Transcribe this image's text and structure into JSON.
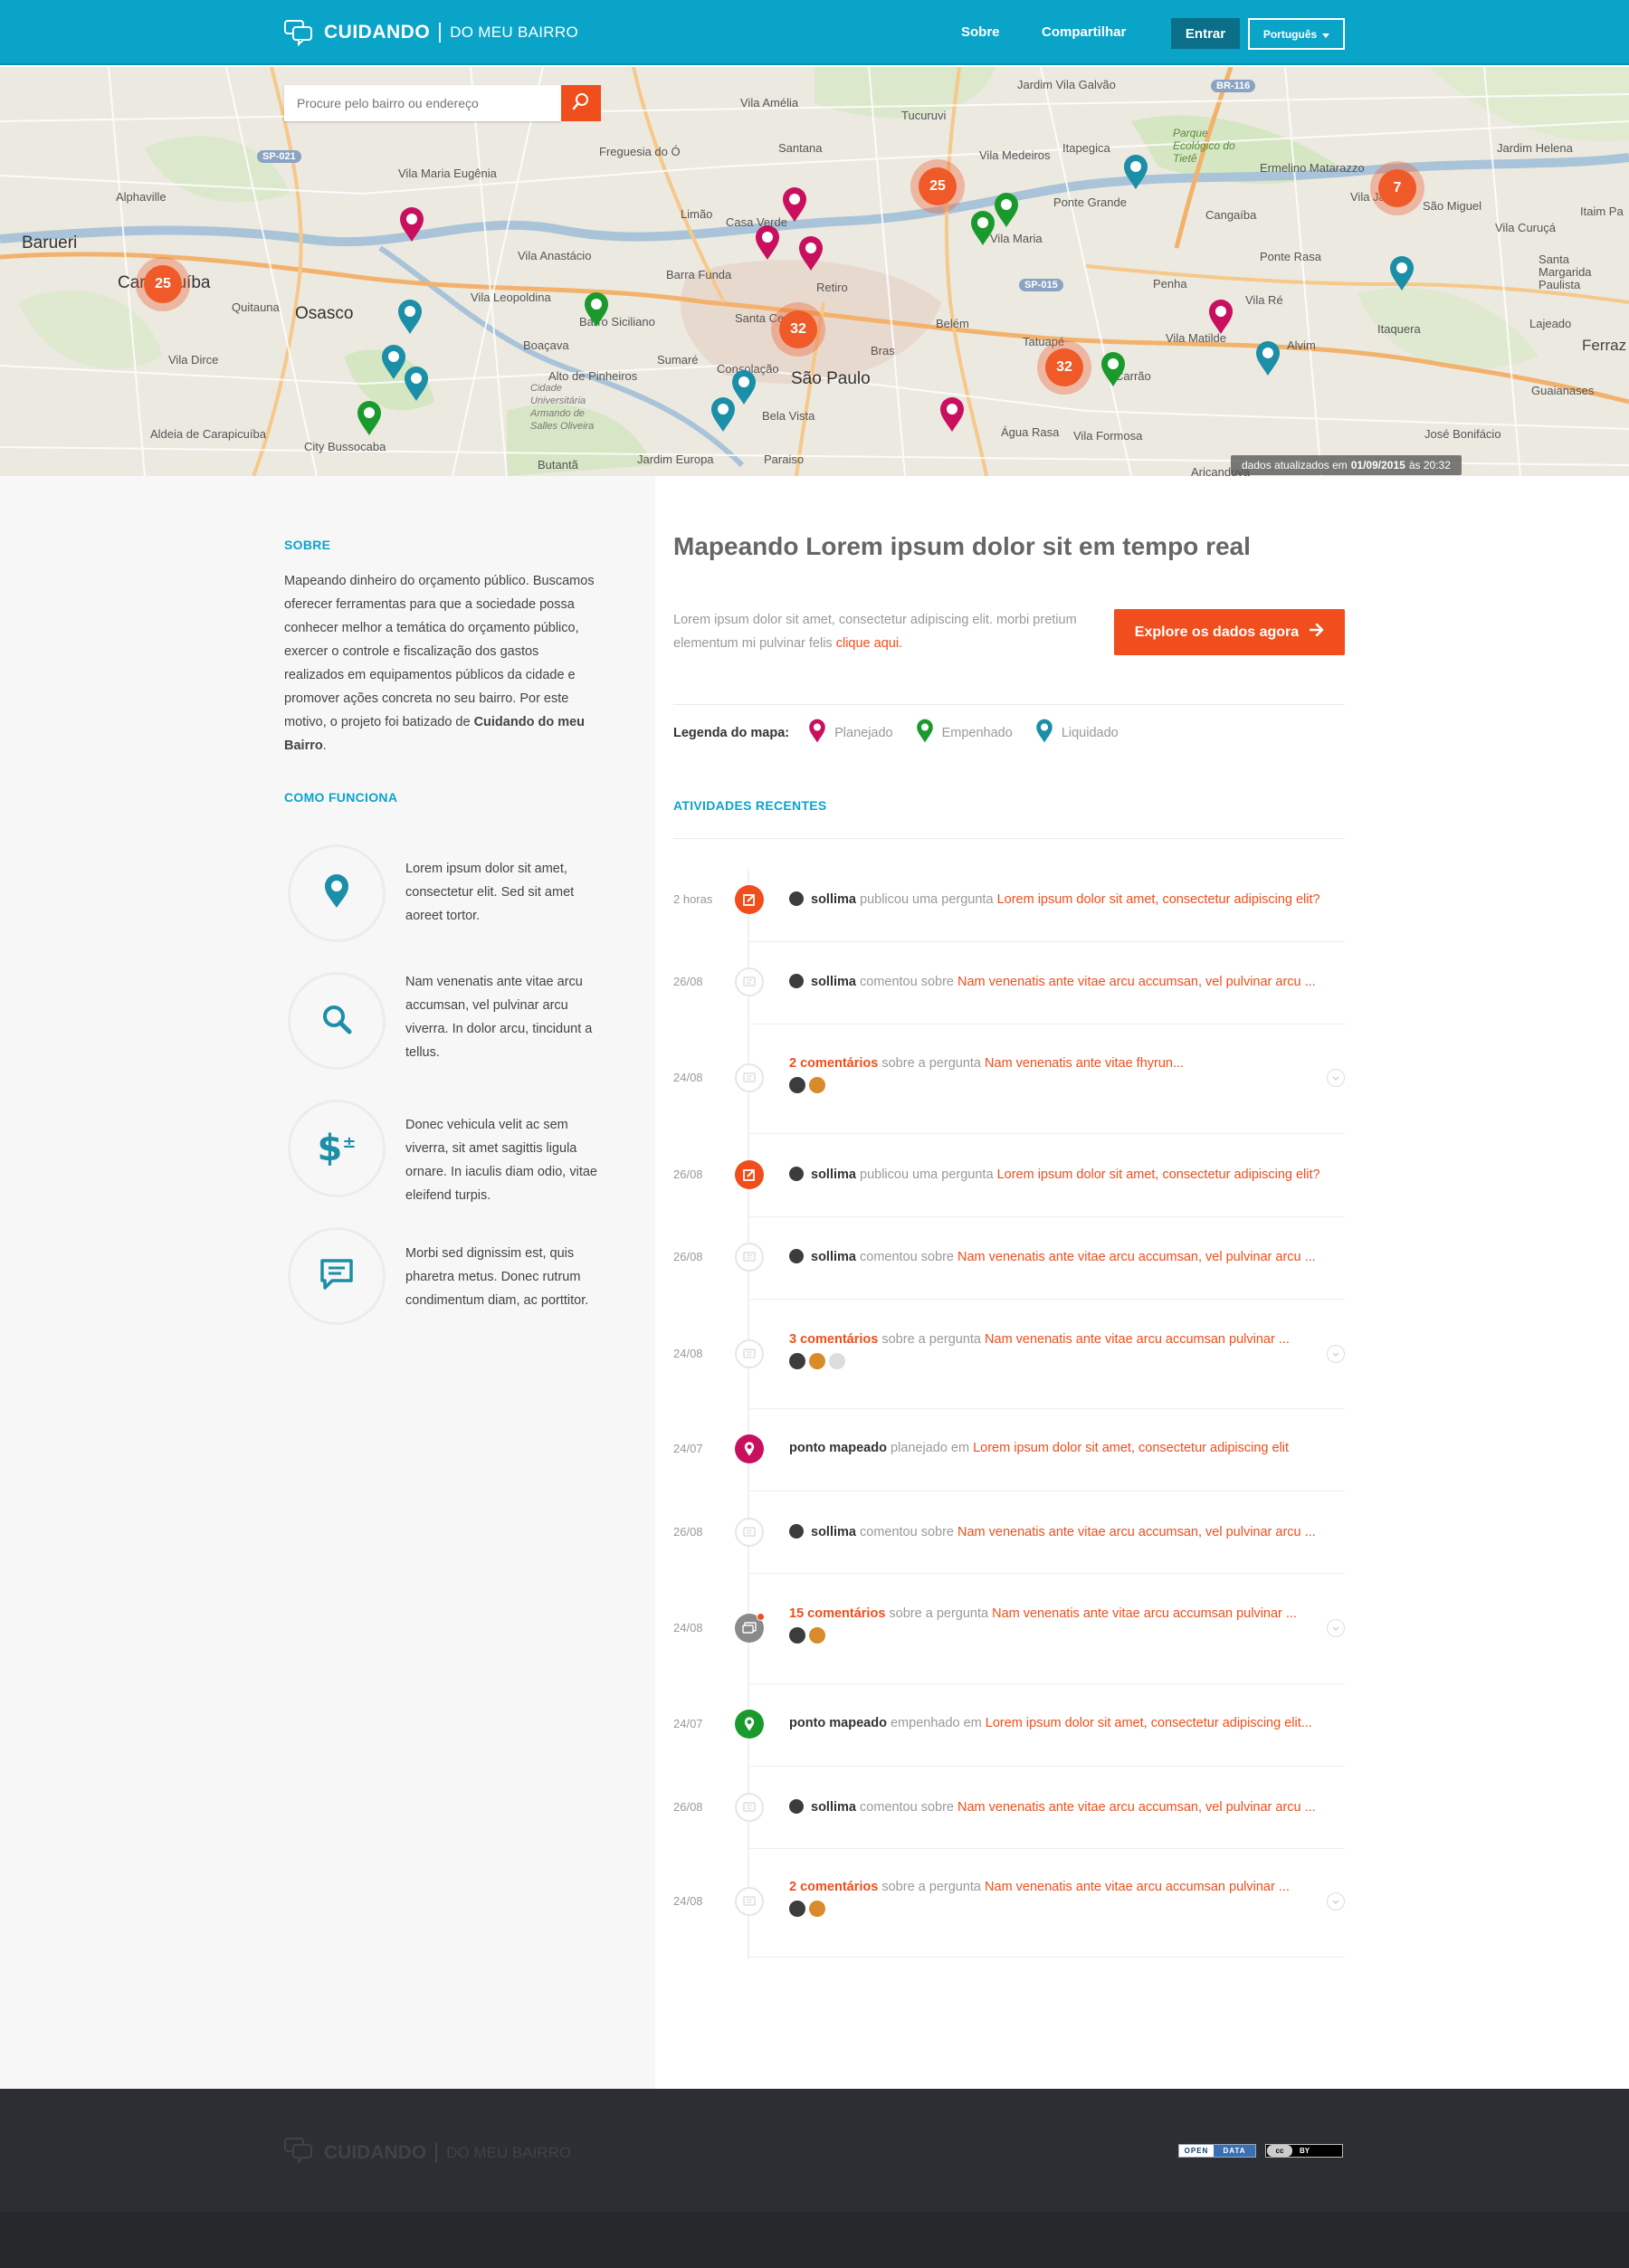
{
  "header": {
    "logo_word1": "CUIDANDO",
    "logo_word2": "DO MEU BAIRRO",
    "nav": [
      "Sobre",
      "Compartilhar"
    ],
    "login_label": "Entrar",
    "language_label": "Português"
  },
  "map": {
    "search_placeholder": "Procure pelo bairro ou endereço",
    "updated_prefix": "dados atualizados em",
    "updated_date": "01/09/2015",
    "updated_mid": "às",
    "updated_time": "20:32",
    "clusters": [
      "25",
      "25",
      "7",
      "32",
      "32"
    ],
    "labels": [
      "Barueri",
      "Alphaville",
      "Osasco",
      "Vila Anastácio",
      "Vila Leopoldina",
      "Boaçava",
      "Alto de Pinheiros",
      "Sumaré",
      "Barra Funda",
      "Santa Cecília",
      "Bela Vista",
      "São Paulo",
      "Bras",
      "Belém",
      "Tatuapé",
      "Vila Formosa",
      "Vila Matilde",
      "Ponte Rasa",
      "Penha",
      "Itaquera",
      "São Miguel",
      "Ermelino Matarazzo",
      "Jardim Helena",
      "Vila Maria",
      "Vila Medeiros",
      "Tucuruvi",
      "Santana",
      "Vila Amélia",
      "Freguesia do Ó",
      "Limão",
      "Casa Verde",
      "Vila Maria Eugênia",
      "Quitauna",
      "Vila Dirce",
      "Aldeia de Carapicuíba",
      "City Bussocaba",
      "Butantã",
      "Jardim Europa",
      "Paraiso",
      "Água Rasa",
      "José Bonifácio",
      "Guaianases",
      "Lajeado",
      "Ferraz",
      "Vila Curuçá",
      "Santa Margarida Paulista",
      "Cangaíba",
      "Vila Ré",
      "Jardim Vila Galvão",
      "Itapegica",
      "Parque Ecológico do Tietê",
      "Vila Jacuí",
      "Itaim Pa",
      "Cidade Universitária Armando de Salles Oliveira",
      "Carapicuíba",
      "Barro Siciliano",
      "Retiro",
      "Consolação",
      "Aricanduva",
      "Carrão",
      "Ponte Grande",
      "SP-021",
      "SP-015",
      "BR-116",
      "Alvim"
    ]
  },
  "sidebar": {
    "about_heading": "SOBRE",
    "about_text_1": "Mapeando dinheiro do orçamento público. Buscamos oferecer ferramentas para que a sociedade possa conhecer melhor a temática do orçamento público, exercer o controle e fiscalização dos gastos realizados em equipamentos públicos da cidade e promover ações concreta no seu bairro. Por este motivo, o projeto foi batizado de ",
    "about_text_bold": "Cuidando do meu Bairro",
    "about_text_end": ".",
    "how_heading": "COMO FUNCIONA",
    "how_items": [
      {
        "icon": "map-pin-icon",
        "text": "Lorem ipsum dolor sit amet, consectetur  elit. Sed sit amet aoreet tortor."
      },
      {
        "icon": "search-icon",
        "text": "Nam venenatis ante vitae arcu accumsan, vel pulvinar arcu viverra. In dolor arcu, tincidunt a tellus."
      },
      {
        "icon": "dollar-plus-minus-icon",
        "text": "Donec vehicula velit ac sem viverra, sit amet sagittis ligula ornare. In iaculis diam odio, vitae eleifend turpis."
      },
      {
        "icon": "chat-bubble-icon",
        "text": "Morbi sed dignissim est, quis pharetra metus. Donec rutrum condimentum diam, ac porttitor."
      }
    ]
  },
  "main": {
    "title": "Mapeando Lorem ipsum dolor sit em tempo real",
    "description": "Lorem ipsum dolor sit amet, consectetur adipiscing elit. morbi pretium elementum mi pulvinar felis ",
    "description_link": "clique aqui.",
    "explore_label": "Explore os dados agora",
    "legend_label": "Legenda do mapa:",
    "legend_items": [
      {
        "label": "Planejado",
        "color": "#c8105f"
      },
      {
        "label": "Empenhado",
        "color": "#1a9a2c"
      },
      {
        "label": "Liquidado",
        "color": "#1b8ea8"
      }
    ],
    "activities_heading": "ATIVIDADES RECENTES",
    "activities": [
      {
        "date": "2 horas",
        "kind": "question",
        "user": "sollima",
        "verb": "publicou uma pergunta",
        "link": "Lorem ipsum dolor sit amet, consectetur adipiscing elit?"
      },
      {
        "date": "26/08",
        "kind": "comment",
        "user": "sollima",
        "verb": "comentou sobre",
        "link": "Nam venenatis ante vitae arcu accumsan, vel pulvinar arcu ..."
      },
      {
        "date": "24/08",
        "kind": "comments",
        "count": "2 comentários",
        "verb": "sobre a pergunta",
        "link": "Nam venenatis ante vitae fhyrun..."
      },
      {
        "date": "26/08",
        "kind": "question",
        "user": "sollima",
        "verb": "publicou uma pergunta",
        "link": "Lorem ipsum dolor sit amet, consectetur adipiscing elit?"
      },
      {
        "date": "26/08",
        "kind": "comment",
        "user": "sollima",
        "verb": "comentou sobre",
        "link": "Nam venenatis ante vitae arcu accumsan, vel pulvinar arcu ..."
      },
      {
        "date": "24/08",
        "kind": "comments",
        "count": "3 comentários",
        "verb": "sobre a pergunta",
        "link": "Nam venenatis ante vitae arcu accumsan pulvinar ..."
      },
      {
        "date": "24/07",
        "kind": "point-planned",
        "user": "ponto mapeado",
        "verb": "planejado em",
        "link": "Lorem ipsum dolor sit amet, consectetur adipiscing elit"
      },
      {
        "date": "26/08",
        "kind": "comment",
        "user": "sollima",
        "verb": "comentou sobre",
        "link": "Nam venenatis ante vitae arcu accumsan, vel pulvinar arcu ..."
      },
      {
        "date": "24/08",
        "kind": "comments-new",
        "count": "15 comentários",
        "verb": "sobre a pergunta",
        "link": "Nam venenatis ante vitae arcu accumsan pulvinar ..."
      },
      {
        "date": "24/07",
        "kind": "point-committed",
        "user": "ponto mapeado",
        "verb": "empenhado em",
        "link": "Lorem ipsum dolor sit amet, consectetur adipiscing elit..."
      },
      {
        "date": "26/08",
        "kind": "comment",
        "user": "sollima",
        "verb": "comentou sobre",
        "link": "Nam venenatis ante vitae arcu accumsan, vel pulvinar arcu ..."
      },
      {
        "date": "24/08",
        "kind": "comments",
        "count": "2 comentários",
        "verb": "sobre a pergunta",
        "link": "Nam venenatis ante vitae arcu accumsan pulvinar ..."
      }
    ]
  },
  "footer": {
    "logo_word1": "CUIDANDO",
    "logo_word2": "DO MEU BAIRRO",
    "badge_open": "OPEN",
    "badge_data": "DATA",
    "badge_cc": "BY"
  },
  "colors": {
    "brand": "#0aa4c9",
    "accent": "#f04e1c",
    "planned": "#c8105f",
    "committed": "#1a9a2c",
    "settled": "#1b8ea8"
  }
}
